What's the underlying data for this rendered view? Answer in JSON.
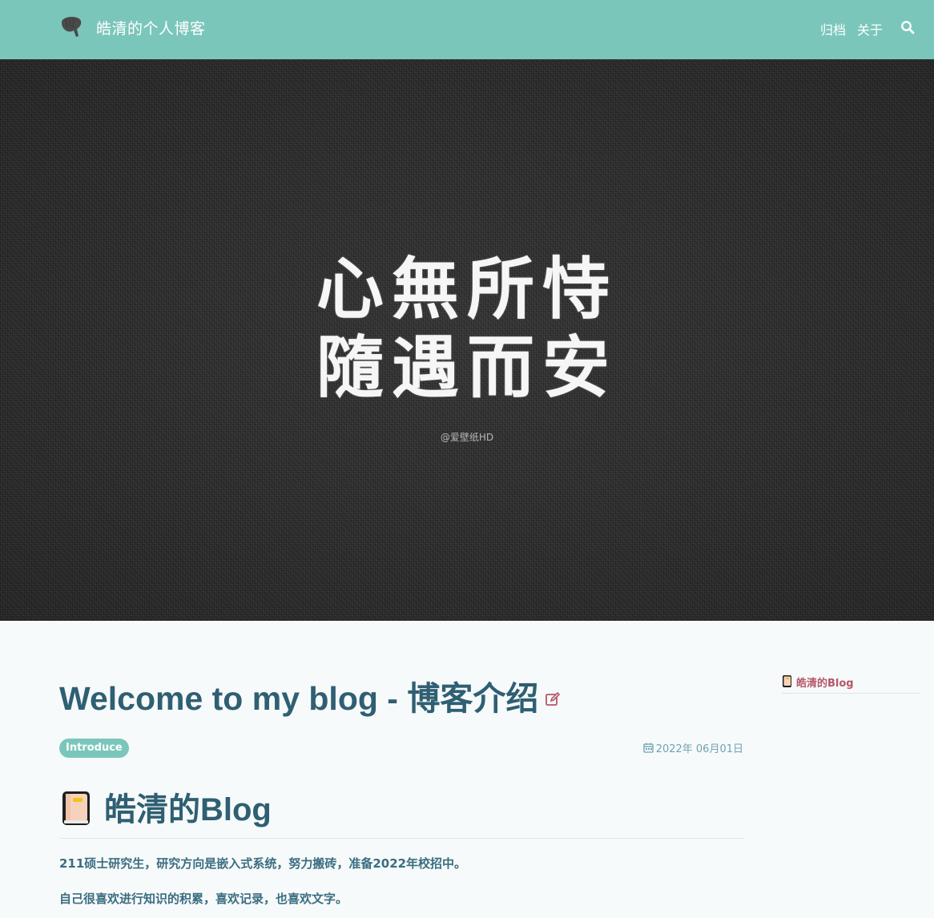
{
  "navbar": {
    "brand_title": "皓清的个人博客",
    "links": [
      "归档",
      "关于"
    ],
    "logo_icon": "ginkgo-leaf-icon",
    "search_icon": "search-icon",
    "background_color": "#7bc6bb"
  },
  "hero": {
    "line_1": "心無所恃",
    "line_2": "隨遇而安",
    "credit": "@爱壁纸HD"
  },
  "post": {
    "title": "Welcome to my blog - 博客介绍",
    "tag": "Introduce",
    "date": "2022年 06月01日",
    "section_heading": "皓清的Blog",
    "paragraphs": [
      "211硕士研究生，研究方向是嵌入式系统，努力搬砖，准备2022年校招中。",
      "自己很喜欢进行知识的积累，喜欢记录，也喜欢文字。"
    ]
  },
  "sidebar": {
    "toc_items": [
      "皓清的Blog"
    ]
  },
  "colors": {
    "accent": "#7bc6bb",
    "heading": "#2f5f73",
    "link": "#b5566a"
  }
}
